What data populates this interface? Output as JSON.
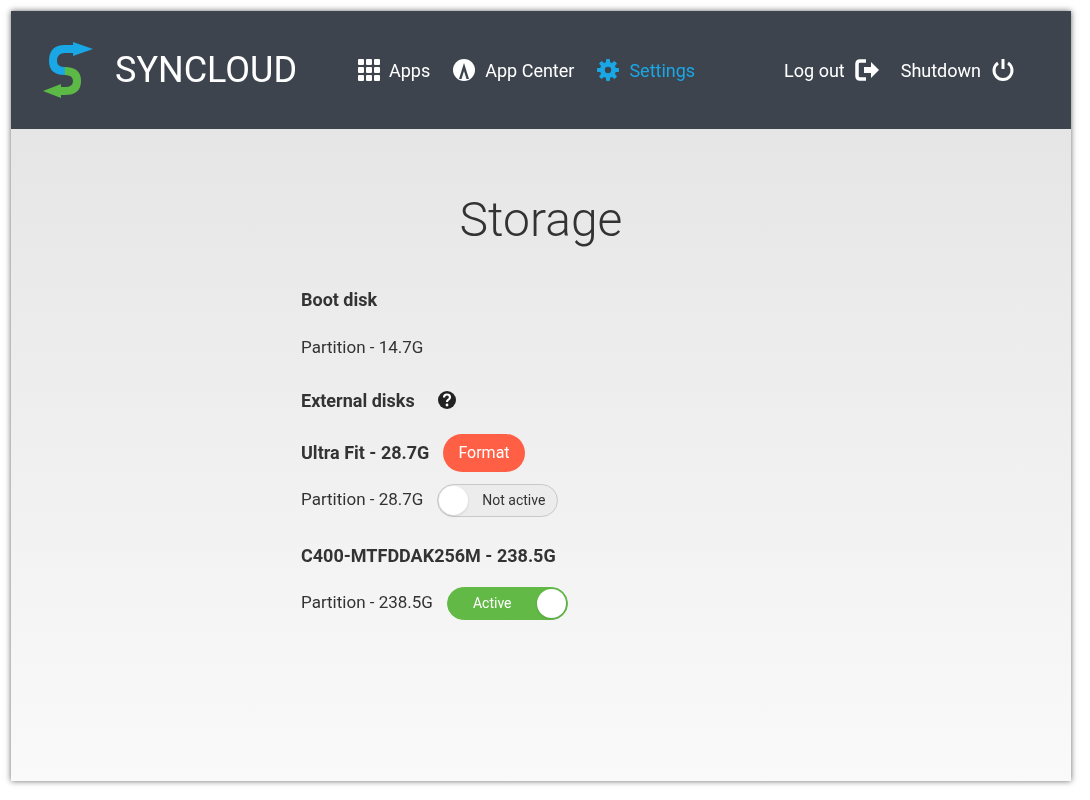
{
  "brand": {
    "name": "SYNCLOUD"
  },
  "nav": [
    {
      "kind": "apps",
      "label": "Apps",
      "selected": false
    },
    {
      "kind": "appcenter",
      "label": "App Center",
      "selected": false
    },
    {
      "kind": "settings",
      "label": "Settings",
      "selected": true
    }
  ],
  "actions": [
    {
      "kind": "logout",
      "label": "Log out"
    },
    {
      "kind": "shutdown",
      "label": "Shutdown"
    }
  ],
  "title": "Storage",
  "boot": {
    "heading": "Boot disk",
    "partitions": [
      {
        "label": "Partition - 14.7G"
      }
    ]
  },
  "external": {
    "heading": "External disks",
    "disks": [
      {
        "name": "Ultra Fit - 28.7G",
        "button": "Format",
        "partitions": [
          {
            "label": "Partition - 28.7G",
            "on": false,
            "state_label": "Not active"
          }
        ]
      },
      {
        "name": "C400-MTFDDAK256M - 238.5G",
        "partitions": [
          {
            "label": "Partition - 238.5G",
            "on": true,
            "state_label": "Active"
          }
        ]
      }
    ]
  }
}
